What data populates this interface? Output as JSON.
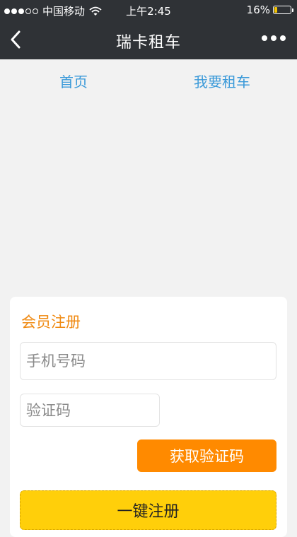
{
  "status_bar": {
    "carrier": "中国移动",
    "time": "上午2:45",
    "battery": "16%",
    "battery_level": 0.16,
    "signal_bars_filled": 3,
    "signal_bars_total": 5
  },
  "nav": {
    "title": "瑞卡租车",
    "back_icon": "chevron-left-icon",
    "more_icon": "more-dots-icon"
  },
  "links": {
    "home": "首页",
    "rent": "我要租车"
  },
  "register_card": {
    "title": "会员注册",
    "phone_placeholder": "手机号码",
    "code_placeholder": "验证码",
    "get_code_label": "获取验证码",
    "register_label": "一键注册"
  },
  "colors": {
    "header_bg": "#2f3236",
    "link": "#3b9ad9",
    "accent_orange": "#ff8a00",
    "title_orange": "#f08a12",
    "register_yellow": "#ffcf0a",
    "page_bg": "#f2f2f2"
  }
}
